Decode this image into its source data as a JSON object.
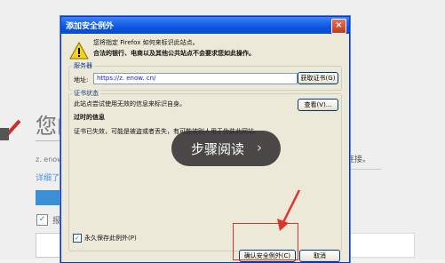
{
  "background_page": {
    "title": "您的",
    "domain": "z. enow",
    "more_link": "详细了",
    "checkbox_label": "报",
    "right_text": "连接。"
  },
  "dialog": {
    "title": "添加安全例外",
    "close_glyph": "×",
    "intro": "您将指定 Firefox 如何来标识此站点。",
    "intro_bold": "合法的银行、电商以及其他公共站点不会要求您如此操作。",
    "server_group_label": "服务器",
    "address_label": "地址:",
    "address_value": "https://z. enow. cn/",
    "get_cert_button": "获取证书(G)",
    "cert_status_group_label": "证书状态",
    "cert_status_line": "此站点尝试使用无效的信息来标识自身。",
    "view_button": "查看(V)...",
    "expired_heading": "过时的信息",
    "expired_detail": "证书已失效，可能是被盗或者丢失，有可能被别人用于伪装此网站。",
    "permanent_label": "永久保存此例外(P)",
    "confirm_button": "确认安全例外(C)",
    "cancel_button": "取消"
  },
  "overlay": {
    "step_button_label": "步骤阅读",
    "step_chevron": "›"
  },
  "colors": {
    "titlebar": "#0a56e0",
    "highlight_box": "#e0342a",
    "step_pill": "#2d2d2d"
  }
}
